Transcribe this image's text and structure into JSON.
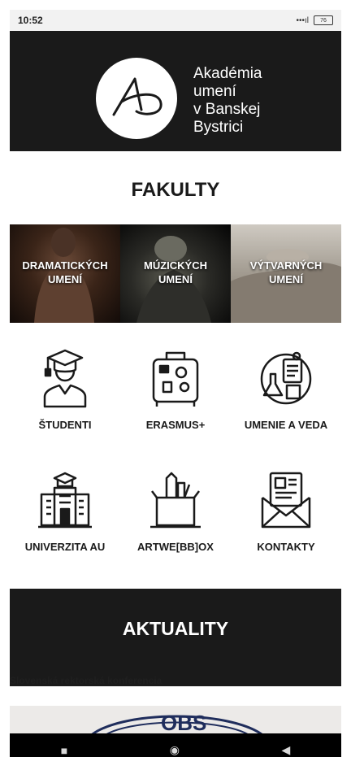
{
  "status": {
    "time": "10:52",
    "signal": "•••ıl",
    "battery": "76"
  },
  "header": {
    "logo_lines": [
      "Akadémia",
      "umení",
      "v Banskej",
      "Bystrici"
    ]
  },
  "faculties": {
    "title": "FAKULTY",
    "items": [
      {
        "line1": "DRAMATICKÝCH",
        "line2": "UMENÍ"
      },
      {
        "line1": "MÚZICKÝCH",
        "line2": "UMENÍ"
      },
      {
        "line1": "VÝTVARNÝCH",
        "line2": "UMENÍ"
      }
    ]
  },
  "menu": {
    "students": "ŠTUDENTI",
    "erasmus": "ERASMUS+",
    "art_science": "UMENIE A VEDA",
    "university": "UNIVERZITA AU",
    "artwebox": "ARTWE[BB]OX",
    "contacts": "KONTAKTY"
  },
  "news": {
    "title": "AKTUALITY",
    "first_item": "Slovenská rektorská konferencia",
    "image_text": "OBS"
  },
  "navbar": {
    "square": "■",
    "circle": "◉",
    "back": "◀"
  }
}
